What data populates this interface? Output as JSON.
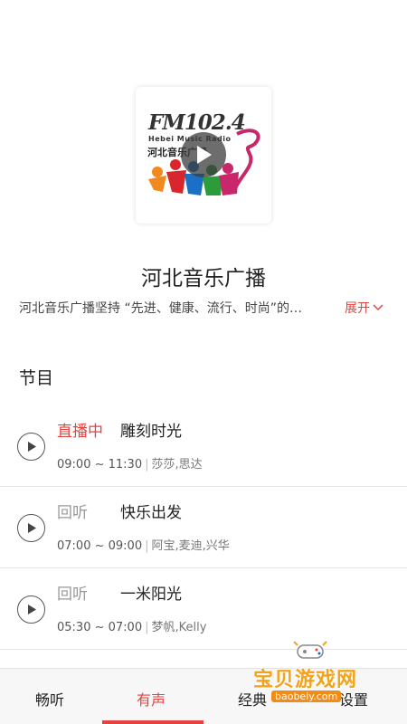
{
  "station": {
    "logo": {
      "fm_text": "FM102.4",
      "sub_text": "Hebei Music Radio",
      "cn_text": "河北音乐广播"
    },
    "title": "河北音乐广播",
    "description": "河北音乐广播坚持 “先进、健康、流行、时尚”的…",
    "expand_label": "展开"
  },
  "section": {
    "title": "节目"
  },
  "programs": [
    {
      "status": "直播中",
      "status_color": "#e64340",
      "name": "雕刻时光",
      "time": "09:00 ~ 11:30",
      "hosts": "莎莎,思达"
    },
    {
      "status": "回听",
      "status_color": "#999999",
      "name": "快乐出发",
      "time": "07:00 ~ 09:00",
      "hosts": "阿宝,麦迪,兴华"
    },
    {
      "status": "回听",
      "status_color": "#999999",
      "name": "一米阳光",
      "time": "05:30 ~ 07:00",
      "hosts": "梦帆,Kelly"
    }
  ],
  "tabs": [
    {
      "label": "畅听",
      "active": false
    },
    {
      "label": "有声",
      "active": true
    },
    {
      "label": "经典",
      "active": false
    },
    {
      "label": "设置",
      "active": false
    }
  ],
  "watermark": {
    "title": "宝贝游戏网",
    "url": "baobeiy.com"
  },
  "colors": {
    "accent": "#e64340",
    "logo_red": "#d8262c",
    "logo_blue": "#1b6fc4",
    "logo_green": "#2a9d3a",
    "logo_orange": "#f08a1f",
    "logo_magenta": "#c8286a"
  }
}
